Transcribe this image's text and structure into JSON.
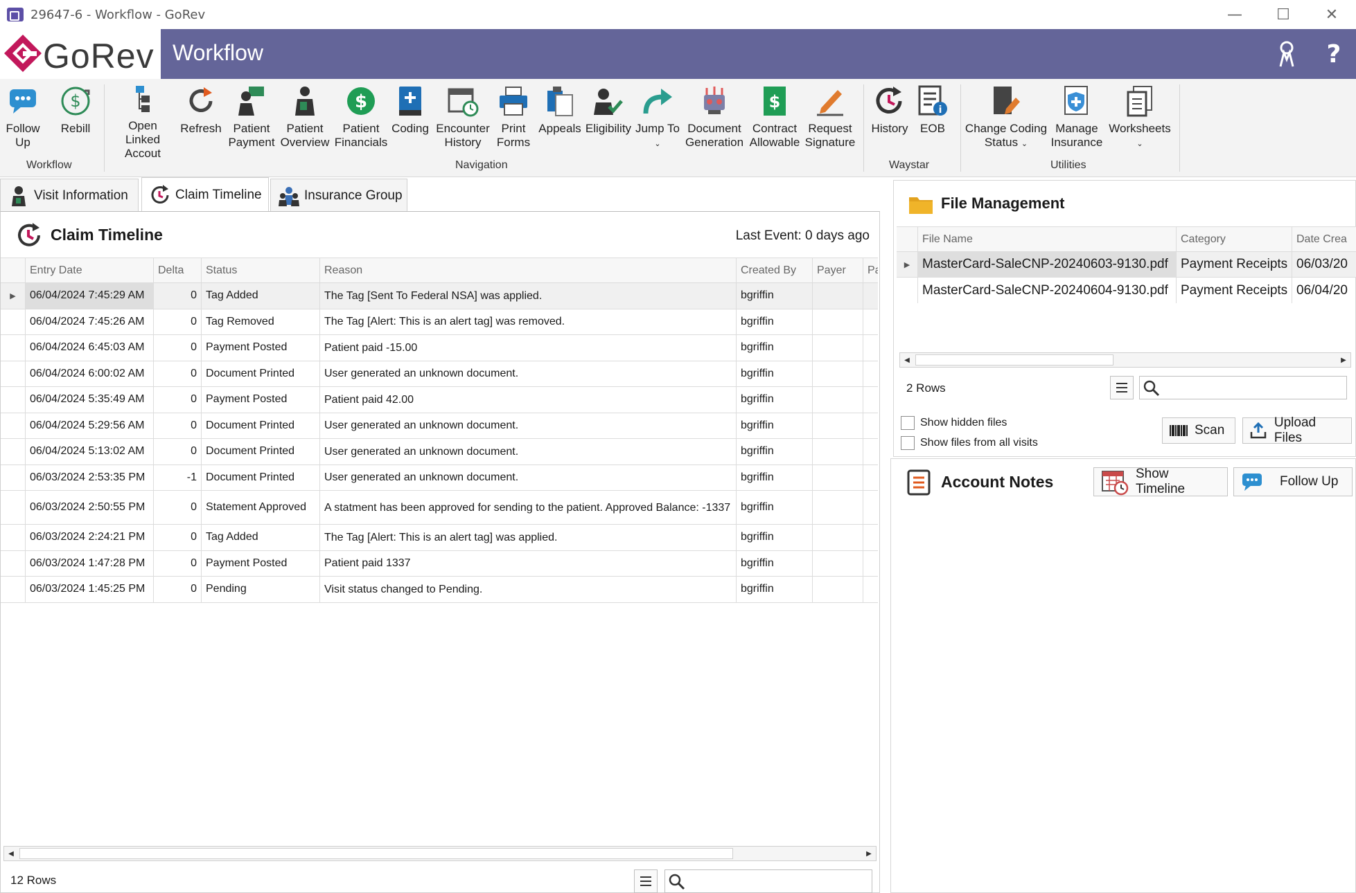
{
  "window": {
    "title": "29647-6 - Workflow - GoRev",
    "minimize": "—",
    "maximize": "☐",
    "close": "✕"
  },
  "header": {
    "logo_text": "GoRev",
    "title": "Workflow",
    "accent": "#646599"
  },
  "ribbon": {
    "buttons": [
      {
        "label": "Follow\nUp",
        "icon": "follow-up-icon"
      },
      {
        "label": "Rebill",
        "icon": "rebill-icon"
      },
      {
        "label": "Open Linked\nAccout",
        "icon": "open-linked-icon"
      },
      {
        "label": "Refresh",
        "icon": "refresh-icon"
      },
      {
        "label": "Patient\nPayment",
        "icon": "patient-payment-icon"
      },
      {
        "label": "Patient\nOverview",
        "icon": "patient-overview-icon"
      },
      {
        "label": "Patient\nFinancials",
        "icon": "patient-financials-icon"
      },
      {
        "label": "Coding",
        "icon": "coding-icon"
      },
      {
        "label": "Encounter\nHistory",
        "icon": "encounter-history-icon"
      },
      {
        "label": "Print\nForms",
        "icon": "print-icon"
      },
      {
        "label": "Appeals",
        "icon": "appeals-icon"
      },
      {
        "label": "Eligibility",
        "icon": "eligibility-icon"
      },
      {
        "label": "Jump To",
        "icon": "jump-to-icon"
      },
      {
        "label": "Document\nGeneration",
        "icon": "document-generation-icon"
      },
      {
        "label": "Contract\nAllowable",
        "icon": "contract-allowable-icon"
      },
      {
        "label": "Request\nSignature",
        "icon": "request-signature-icon"
      },
      {
        "label": "History",
        "icon": "history-icon"
      },
      {
        "label": "EOB",
        "icon": "eob-icon"
      },
      {
        "label": "Change Coding\nStatus",
        "icon": "change-coding-status-icon"
      },
      {
        "label": "Manage\nInsurance",
        "icon": "manage-insurance-icon"
      },
      {
        "label": "Worksheets",
        "icon": "worksheets-icon"
      }
    ],
    "groups": {
      "workflow": "Workflow",
      "navigation": "Navigation",
      "waystar": "Waystar",
      "utilities": "Utilities"
    }
  },
  "tabs": [
    {
      "label": "Visit Information"
    },
    {
      "label": "Claim Timeline"
    },
    {
      "label": "Insurance Group"
    }
  ],
  "timeline": {
    "title": "Claim Timeline",
    "last_event": "Last Event: 0 days ago",
    "columns": [
      "Entry Date",
      "Delta",
      "Status",
      "Reason",
      "Created By",
      "Payer",
      "Pa"
    ],
    "rows": [
      {
        "date": "06/04/2024 7:45:29 AM",
        "delta": "0",
        "status": "Tag Added",
        "reason": "The Tag [Sent To Federal NSA] was applied.",
        "created_by": "bgriffin"
      },
      {
        "date": "06/04/2024 7:45:26 AM",
        "delta": "0",
        "status": "Tag Removed",
        "reason": "The Tag [Alert: This is an alert tag] was removed.",
        "created_by": "bgriffin"
      },
      {
        "date": "06/04/2024 6:45:03 AM",
        "delta": "0",
        "status": "Payment Posted",
        "reason": "Patient paid -15.00",
        "created_by": "bgriffin"
      },
      {
        "date": "06/04/2024 6:00:02 AM",
        "delta": "0",
        "status": "Document Printed",
        "reason": "User generated an unknown document.",
        "created_by": "bgriffin"
      },
      {
        "date": "06/04/2024 5:35:49 AM",
        "delta": "0",
        "status": "Payment Posted",
        "reason": "Patient paid 42.00",
        "created_by": "bgriffin"
      },
      {
        "date": "06/04/2024 5:29:56 AM",
        "delta": "0",
        "status": "Document Printed",
        "reason": "User generated an unknown document.",
        "created_by": "bgriffin"
      },
      {
        "date": "06/04/2024 5:13:02 AM",
        "delta": "0",
        "status": "Document Printed",
        "reason": "User generated an unknown document.",
        "created_by": "bgriffin"
      },
      {
        "date": "06/03/2024 2:53:35 PM",
        "delta": "-1",
        "status": "Document Printed",
        "reason": "User generated an unknown document.",
        "created_by": "bgriffin"
      },
      {
        "date": "06/03/2024 2:50:55 PM",
        "delta": "0",
        "status": "Statement Approved",
        "reason": "A statment has been approved for sending to the patient. Approved Balance: -1337",
        "created_by": "bgriffin"
      },
      {
        "date": "06/03/2024 2:24:21 PM",
        "delta": "0",
        "status": "Tag Added",
        "reason": "The Tag [Alert: This is an alert tag] was applied.",
        "created_by": "bgriffin"
      },
      {
        "date": "06/03/2024 1:47:28 PM",
        "delta": "0",
        "status": "Payment Posted",
        "reason": "Patient paid 1337",
        "created_by": "bgriffin"
      },
      {
        "date": "06/03/2024 1:45:25 PM",
        "delta": "0",
        "status": "Pending",
        "reason": "Visit status changed to Pending.",
        "created_by": "bgriffin"
      }
    ],
    "row_count": "12 Rows",
    "search_placeholder": ""
  },
  "file_management": {
    "title": "File Management",
    "columns": [
      "File Name",
      "Category",
      "Date Crea"
    ],
    "rows": [
      {
        "name": "MasterCard-SaleCNP-20240603-9130.pdf",
        "category": "Payment Receipts",
        "date": "06/03/20"
      },
      {
        "name": "MasterCard-SaleCNP-20240604-9130.pdf",
        "category": "Payment Receipts",
        "date": "06/04/20"
      }
    ],
    "row_count": "2 Rows",
    "show_hidden": "Show hidden files",
    "show_all_visits": "Show files from all visits",
    "scan": "Scan",
    "upload": "Upload Files"
  },
  "account_notes": {
    "title": "Account Notes",
    "show_timeline": "Show Timeline",
    "follow_up": "Follow Up"
  }
}
